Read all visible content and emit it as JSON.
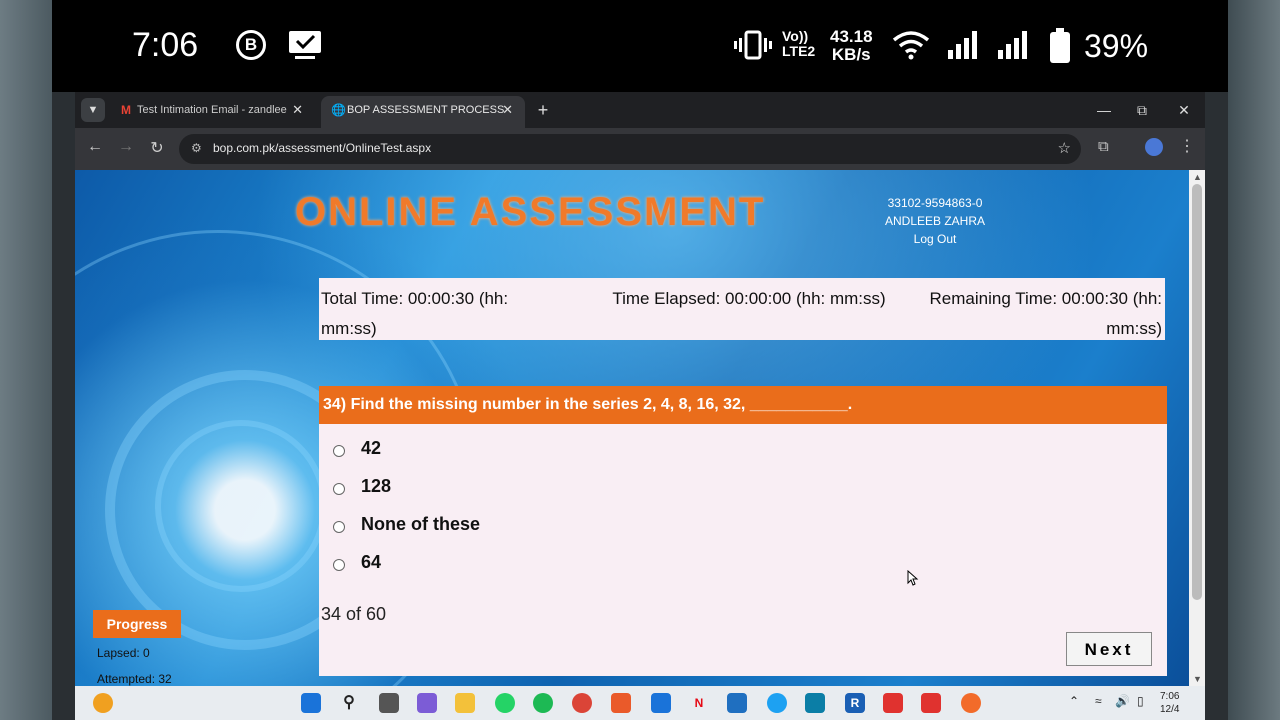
{
  "status_bar": {
    "time": "7:06",
    "volte_line1": "Vo))",
    "volte_line2": "LTE2",
    "speed_value": "43.18",
    "speed_unit": "KB/s",
    "battery": "39%"
  },
  "browser": {
    "tabs": [
      {
        "label": "Test Intimation Email - zandleeb",
        "favicon": "gmail-icon"
      },
      {
        "label": "BOP ASSESSMENT PROCESS",
        "favicon": "globe-icon"
      }
    ],
    "url": "bop.com.pk/assessment/OnlineTest.aspx"
  },
  "page": {
    "title": "ONLINE ASSESSMENT",
    "user_id": "33102-9594863-0",
    "user_name": "ANDLEEB ZAHRA",
    "logout": "Log Out",
    "timer": {
      "total": "Total Time: 00:00:30 (hh: mm:ss)",
      "elapsed": "Time Elapsed: 00:00:00 (hh: mm:ss)",
      "remaining": "Remaining Time: 00:00:30 (hh: mm:ss)"
    },
    "question": "34) Find the missing number in the series 2, 4, 8, 16, 32, ___________.",
    "options": [
      "42",
      "128",
      "None of these",
      "64"
    ],
    "counter": "34 of 60",
    "next": "Next",
    "progress": {
      "label": "Progress",
      "lapsed": "Lapsed: 0",
      "attempted": "Attempted: 32"
    }
  },
  "taskbar": {
    "clock_time": "7:06",
    "clock_date": "12/4"
  },
  "colors": {
    "accent_orange": "#ea6d1b",
    "panel_pink": "#f9eef4",
    "page_blue": "#1f8fd8"
  }
}
